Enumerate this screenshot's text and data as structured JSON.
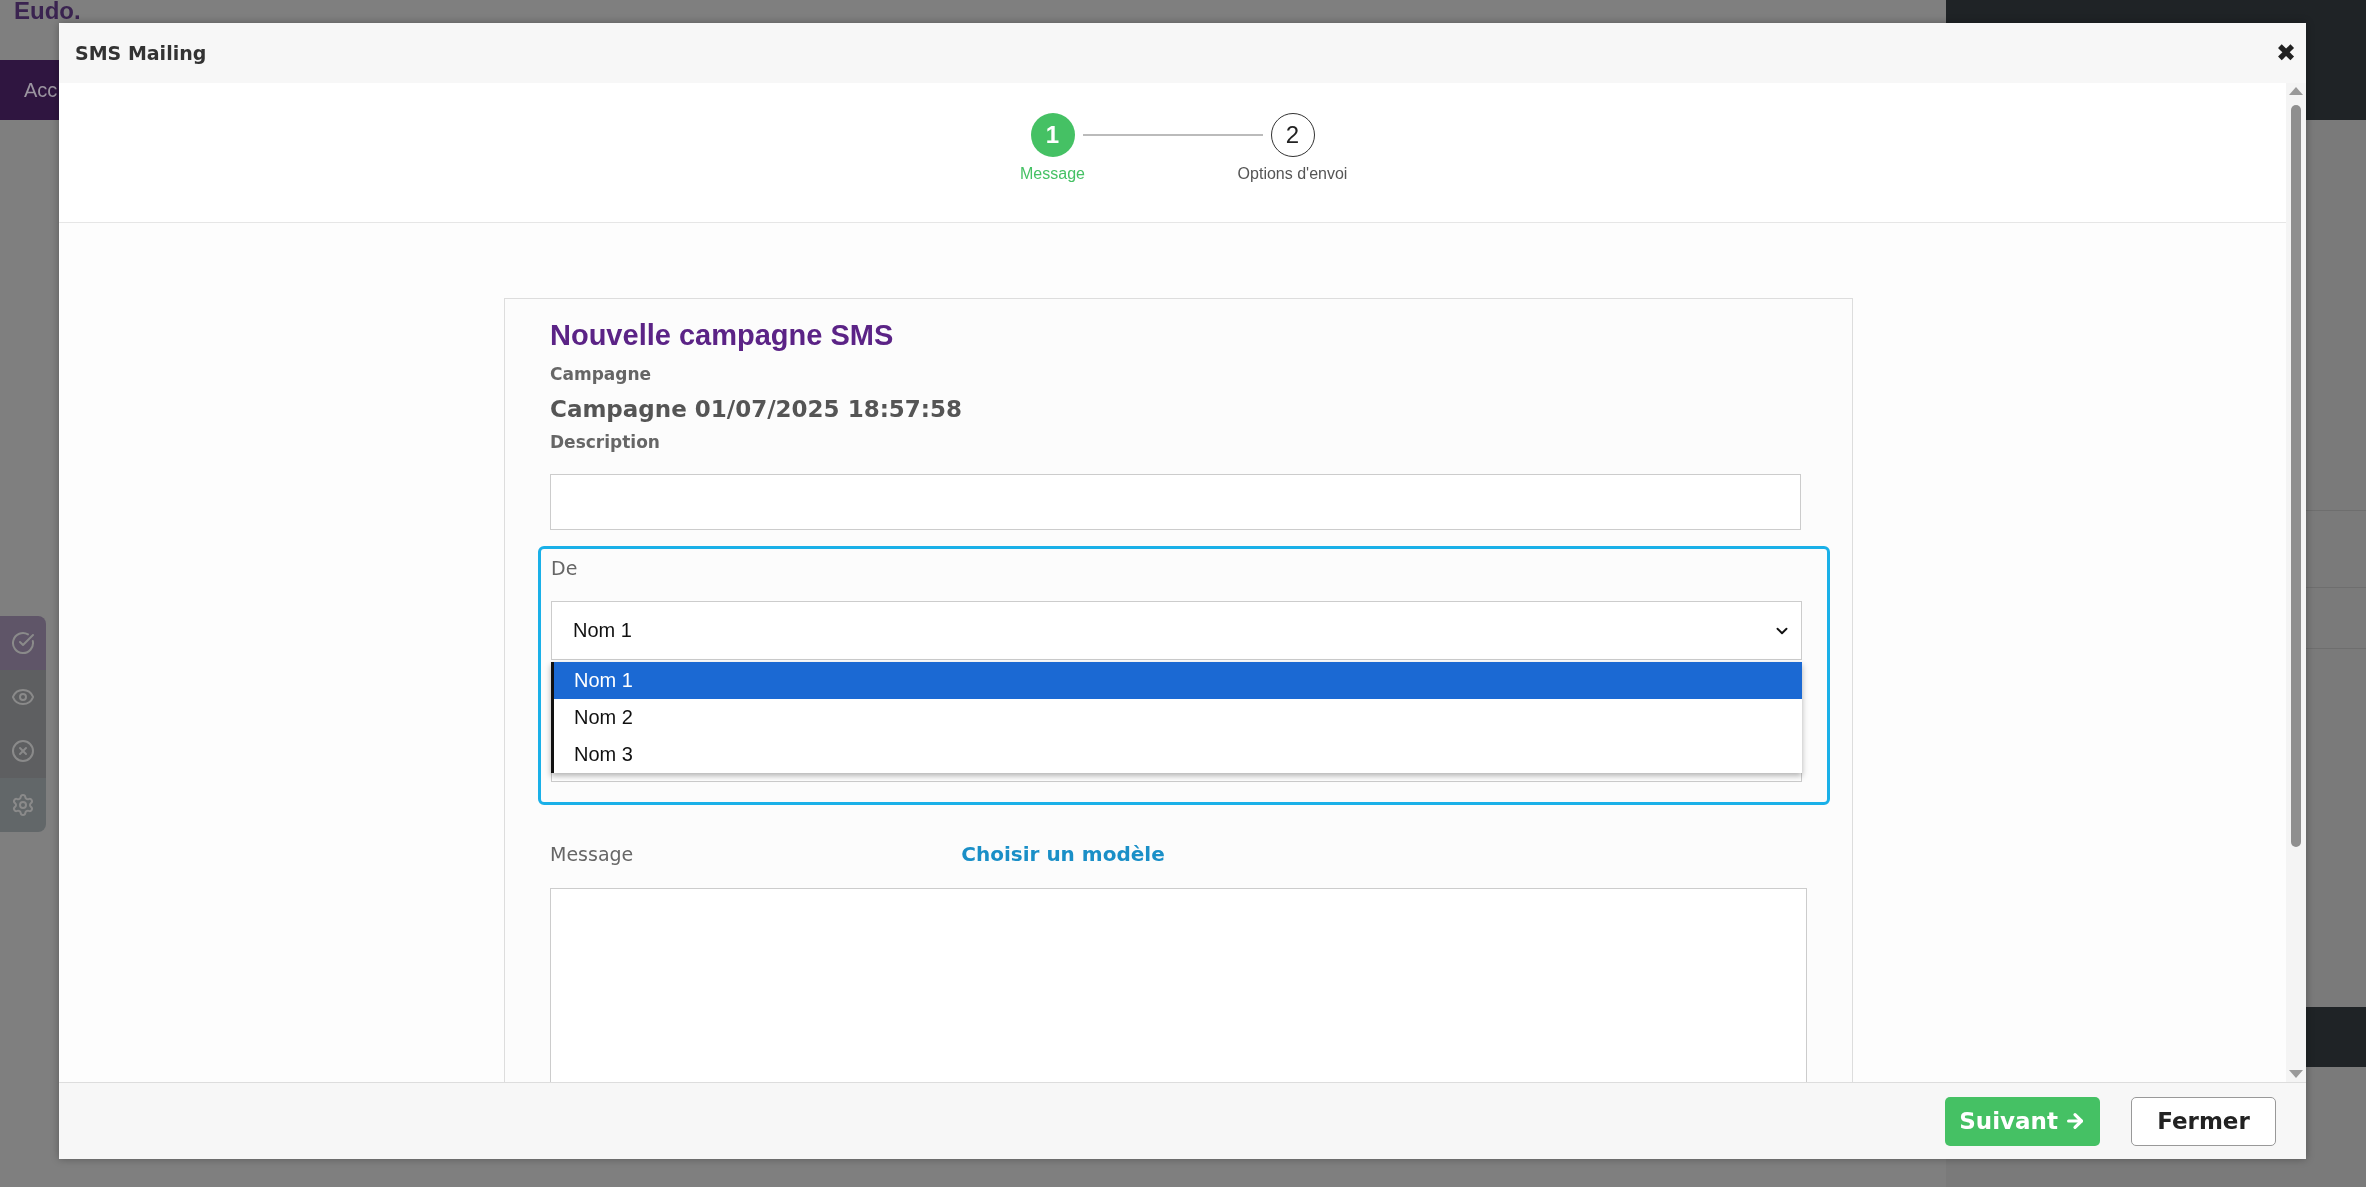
{
  "background": {
    "logo": "Eudo.",
    "nav_tab": "Acc"
  },
  "dialog": {
    "title": "SMS Mailing",
    "close": "✖"
  },
  "steps": [
    {
      "number": "1",
      "label": "Message",
      "selected": true
    },
    {
      "number": "2",
      "label": "Options d'envoi",
      "selected": false
    }
  ],
  "form": {
    "heading": "Nouvelle campagne SMS",
    "campaign_label": "Campagne",
    "campaign_value": "Campagne 01/07/2025 18:57:58",
    "description_label": "Description",
    "from_label": "De",
    "from_value": "Nom 1",
    "from_options": [
      {
        "label": "Nom 1",
        "selected": true
      },
      {
        "label": "Nom 2",
        "selected": false
      },
      {
        "label": "Nom 3",
        "selected": false
      }
    ],
    "template_link": "Choisir un modèle",
    "message_label": "Message"
  },
  "buttons": [
    {
      "label": "Suivant",
      "kind": "primary"
    },
    {
      "label": "Fermer",
      "kind": "secondary"
    }
  ]
}
